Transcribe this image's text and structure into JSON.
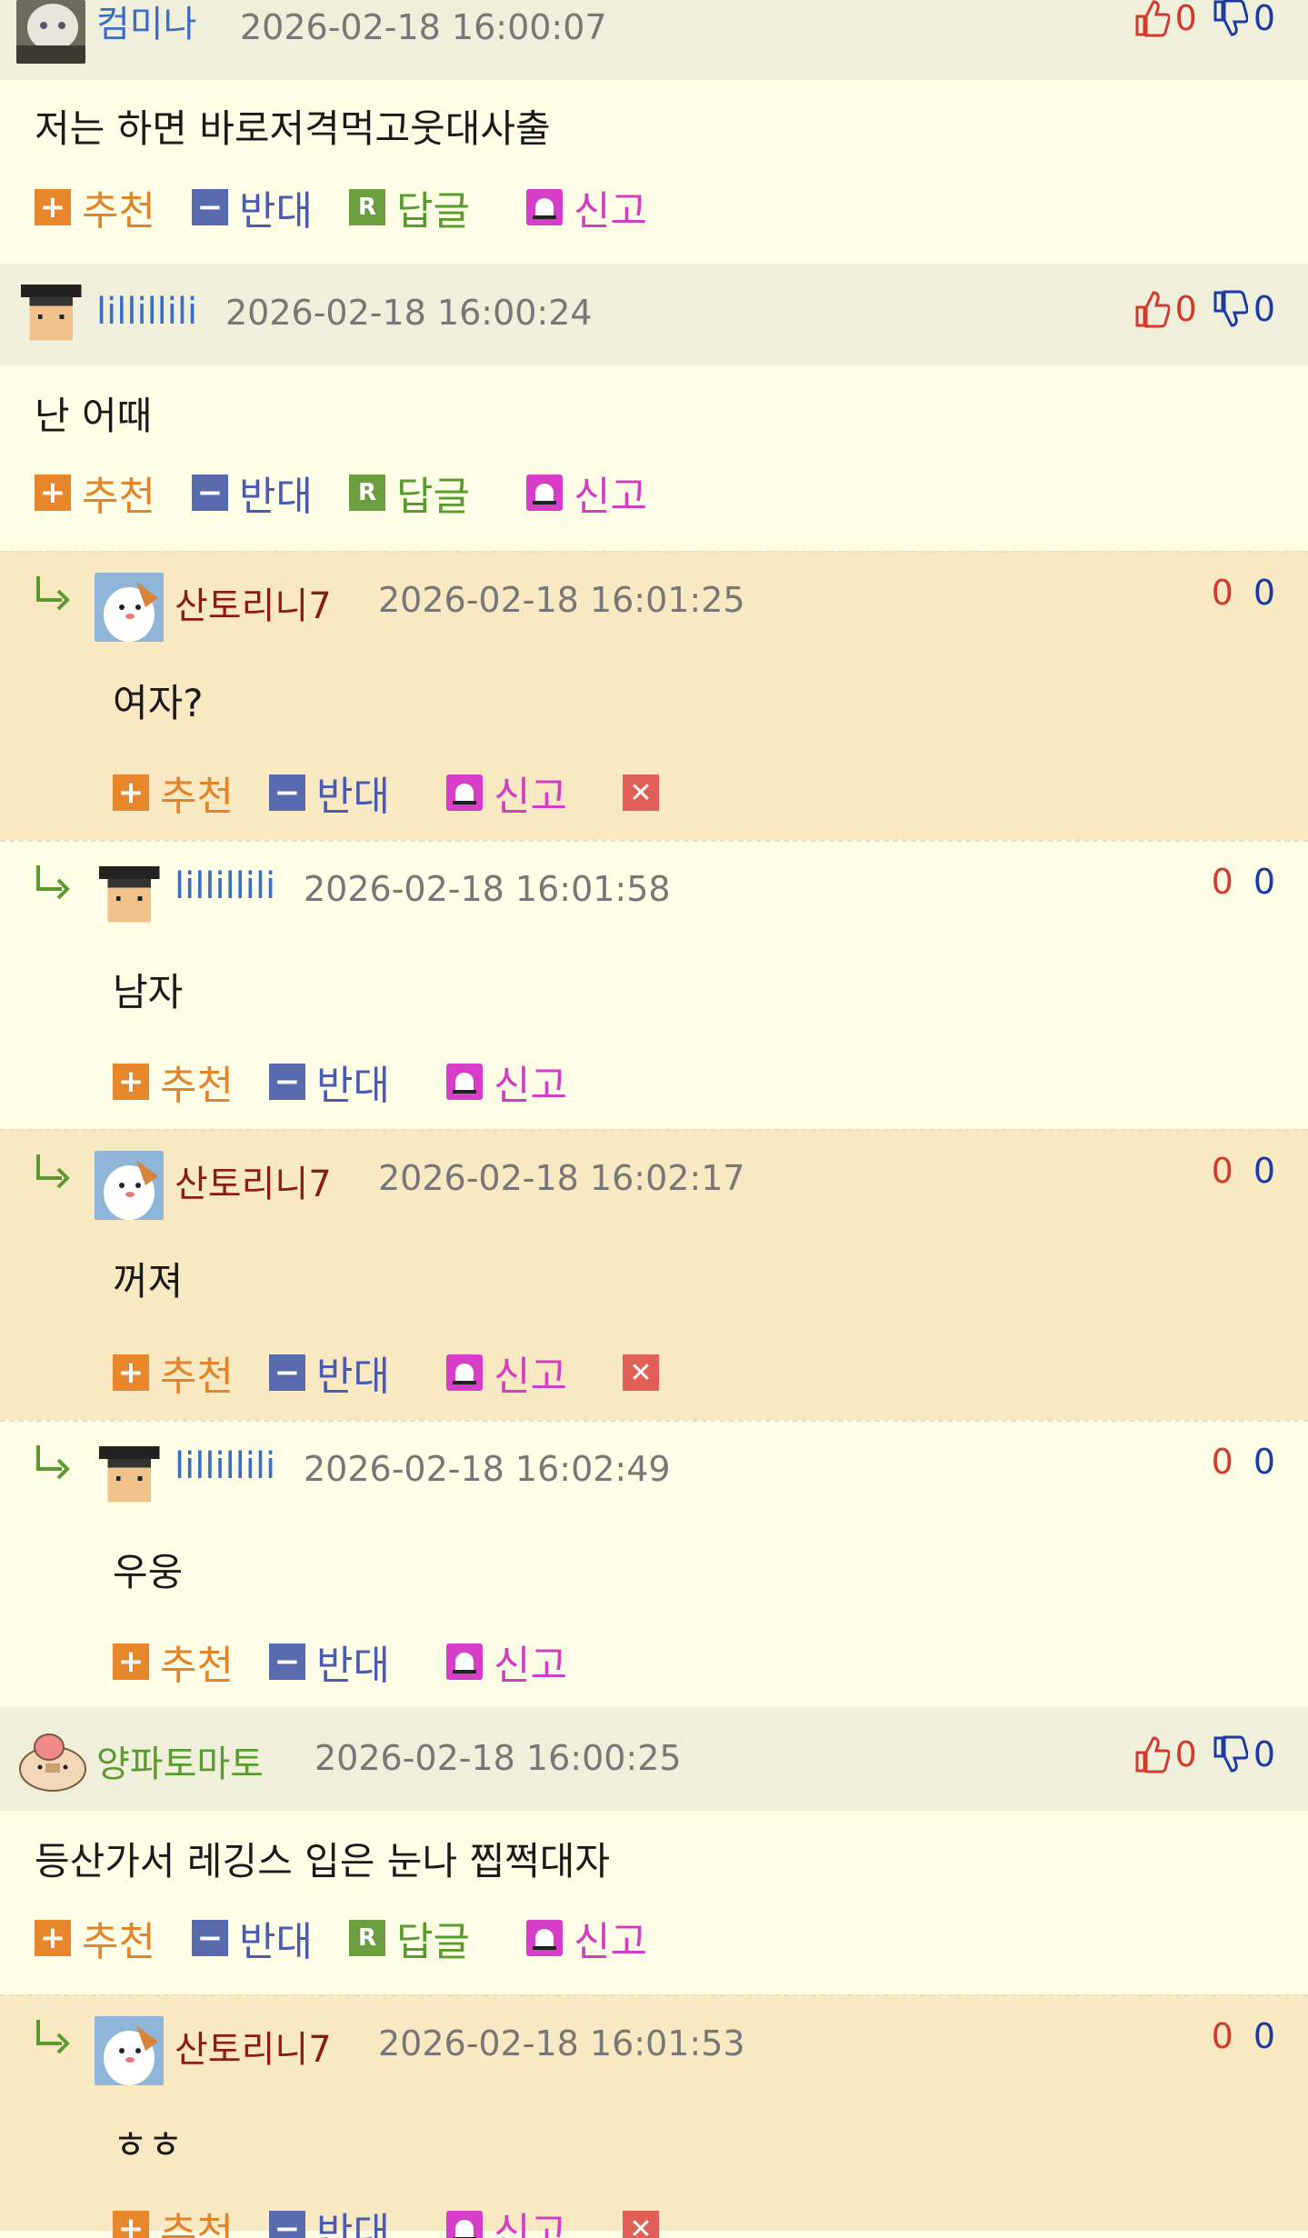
{
  "comments": [
    {
      "nick": "컴미나",
      "date": "2026-02-18 16:00:07",
      "up": "0",
      "down": "0",
      "text": "저는 하면 바로저격먹고웃대사출",
      "avatar": "white-cat-photo"
    },
    {
      "nick": "lillillili",
      "date": "2026-02-18 16:00:24",
      "up": "0",
      "down": "0",
      "text": "난 어때",
      "avatar": "graduate-cap-pixel"
    },
    {
      "nick": "양파토마토",
      "date": "2026-02-18 16:00:25",
      "up": "0",
      "down": "0",
      "text": "등산가서 레깅스 입은 눈나 찝쩍대자",
      "avatar": "onion-tomato-character"
    }
  ],
  "replies": [
    {
      "nick": "산토리니7",
      "date": "2026-02-18 16:01:25",
      "up": "0",
      "down": "0",
      "text": "여자?",
      "deletable": true
    },
    {
      "nick": "lillillili",
      "date": "2026-02-18 16:01:58",
      "up": "0",
      "down": "0",
      "text": "남자",
      "deletable": false
    },
    {
      "nick": "산토리니7",
      "date": "2026-02-18 16:02:17",
      "up": "0",
      "down": "0",
      "text": "꺼져",
      "deletable": true
    },
    {
      "nick": "lillillili",
      "date": "2026-02-18 16:02:49",
      "up": "0",
      "down": "0",
      "text": "우웅",
      "deletable": false
    },
    {
      "nick": "산토리니7",
      "date": "2026-02-18 16:01:53",
      "up": "0",
      "down": "0",
      "text": "ㅎㅎ",
      "deletable": true
    }
  ],
  "actions": {
    "recommend": "추천",
    "oppose": "반대",
    "reply": "답글",
    "report": "신고",
    "plus_glyph": "+",
    "minus_glyph": "−",
    "reply_glyph": "R",
    "delete_glyph": "✕"
  },
  "colors": {
    "header_bg": "#efefdb",
    "body_bg": "#fefee6",
    "reply_tan": "#f8e9c3",
    "nick_blue": "#3a6dc4",
    "nick_green": "#5a9a2e",
    "nick_red": "#8c1c12",
    "up_red": "#d23a2c",
    "down_blue": "#1b3aa4"
  }
}
